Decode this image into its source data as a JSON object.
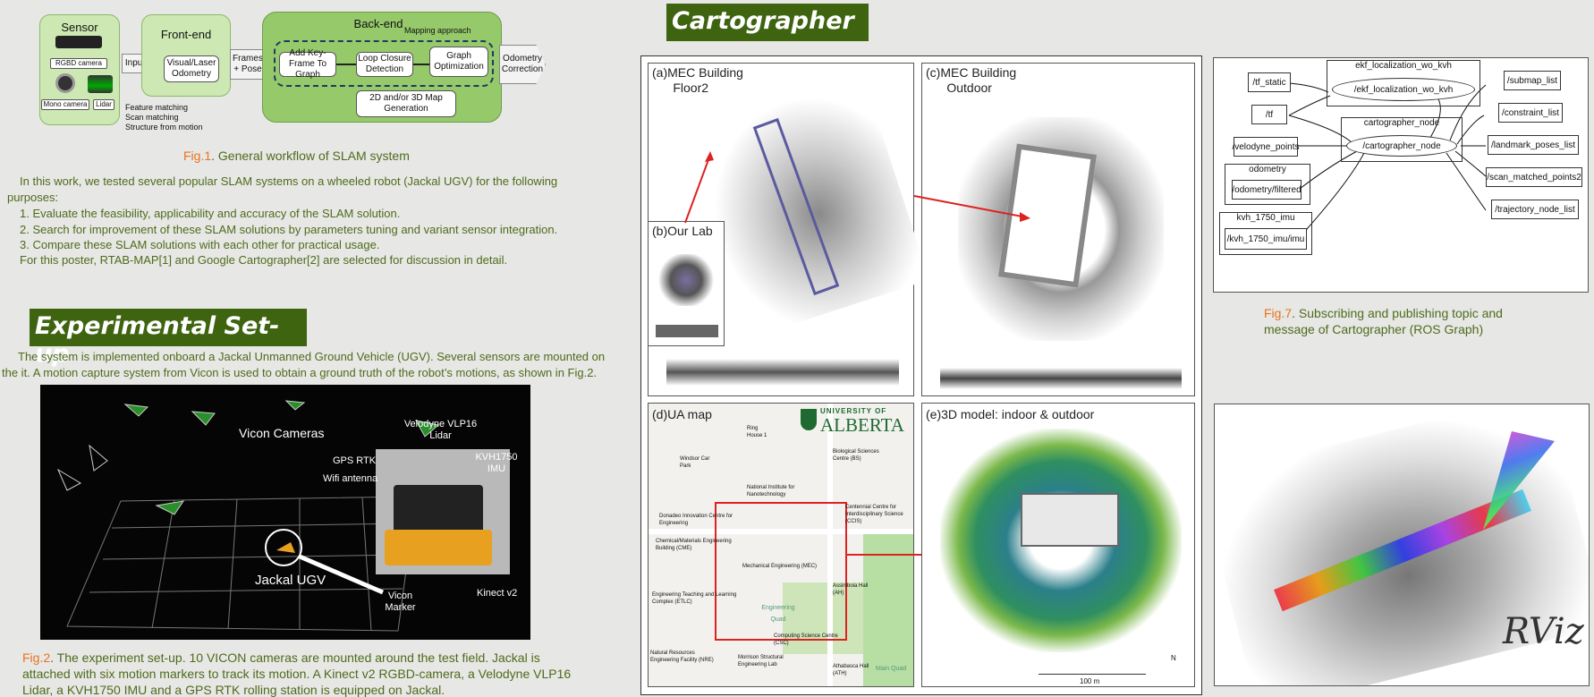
{
  "workflow": {
    "sensor_title": "Sensor",
    "rgbd_label": "RGBD camera",
    "mono_label": "Mono camera",
    "lidar_label": "Lidar",
    "input_label": "Input",
    "frontend_title": "Front-end",
    "odometry_box": "Visual/Laser Odometry",
    "frontend_notes": [
      "Feature matching",
      "Scan matching",
      "Structure from motion"
    ],
    "frames_label": "Frames + Pose",
    "backend_title": "Back-end",
    "mapping_approach": "Mapping approach",
    "step1": "Add Key-Frame To Graph",
    "step2": "Loop Closure Detection",
    "step3": "Graph Optimization",
    "map_gen": "2D and/or 3D Map Generation",
    "output_label": "Odometry Correction"
  },
  "fig1_caption": {
    "fig": "Fig.1",
    "text": ". General workflow of SLAM system"
  },
  "intro": {
    "lead": "In this work, we tested several popular SLAM systems on a wheeled robot (Jackal UGV) for the following purposes:",
    "items": [
      "1. Evaluate the feasibility, applicability and accuracy of the SLAM solution.",
      "2. Search for improvement of these SLAM solutions by parameters tuning and variant sensor integration.",
      "3. Compare these SLAM solutions with each other for practical usage."
    ],
    "closing": "For this poster, RTAB-MAP[1] and Google Cartographer[2] are selected for discussion in detail."
  },
  "experimental": {
    "title": "Experimental Set-up",
    "text": "The system is implemented onboard a Jackal Unmanned Ground Vehicle (UGV). Several sensors are mounted on the it. A motion capture system from Vicon is used to obtain a ground truth of the robot’s motions, as shown in Fig.2.",
    "photo_labels": {
      "vicon": "Vicon Cameras",
      "velodyne": "Velodyne VLP16 Lidar",
      "gps": "GPS RTK",
      "kvh": "KVH1750 IMU",
      "wifi": "Wifi antenna",
      "jackal": "Jackal UGV",
      "marker": "Vicon Marker",
      "kinect": "Kinect v2"
    }
  },
  "fig2_caption": {
    "fig": "Fig.2",
    "text": ".  The experiment set-up. 10 VICON cameras are mounted around the test field. Jackal is attached with six motion markers to track its motion. A Kinect v2 RGBD-camera, a Velodyne VLP16 Lidar, a KVH1750 IMU and a GPS RTK rolling station is equipped on Jackal."
  },
  "cartographer": {
    "title": "Cartographer",
    "panel_a": "(a)MEC Building\n      Floor2",
    "panel_b": "(b)Our Lab",
    "panel_c": "(c)MEC Building\n      Outdoor",
    "panel_d": "(d)UA map",
    "panel_e": "(e)3D model: indoor & outdoor",
    "ua_logo_top": "UNIVERSITY OF",
    "ua_logo_bottom": "ALBERTA",
    "map_labels": [
      "Ring House 1",
      "Biological Sciences Centre (BS)",
      "Windsor Car Park",
      "National Institute for Nanotechnology",
      "Donadeo Innovation Centre for Engineering",
      "Centennial Centre for Interdisciplinary Science (CCIS)",
      "Chemical/Materials Engineering Building (CME)",
      "Mechanical Engineering (MEC)",
      "Engineering Teaching and Learning Complex (ETLC)",
      "Assiniboia Hall (AH)",
      "Engineering Quad",
      "Computing Science Centre (CSC)",
      "Natural Resources Engineering Facility (NRE)",
      "Morrison Structural Engineering Lab",
      "Athabasca Hall (ATH)",
      "Main Quad"
    ],
    "scale_label": "100 m",
    "north": "N"
  },
  "ros_graph": {
    "group_ekf": "ekf_localization_wo_kvh",
    "ekf_node": "/ekf_localization_wo_kvh",
    "group_carto": "cartographer_node",
    "carto_node": "/cartographer_node",
    "group_odom": "odometry",
    "group_imu": "kvh_1750_imu",
    "inputs": [
      "/tf_static",
      "/tf",
      "/velodyne_points",
      "/odometry/filtered",
      "/kvh_1750_imu/imu"
    ],
    "outputs": [
      "/submap_list",
      "/constraint_list",
      "/landmark_poses_list",
      "/scan_matched_points2",
      "/trajectory_node_list"
    ]
  },
  "fig7_caption": {
    "fig": "Fig.7",
    "text": ". Subscribing and publishing topic and message of Cartographer (ROS Graph)"
  },
  "rviz_logo": "RViz",
  "colors": {
    "accent": "#3e6410",
    "figure_label": "#e8731e",
    "text": "#4e6b1c"
  }
}
